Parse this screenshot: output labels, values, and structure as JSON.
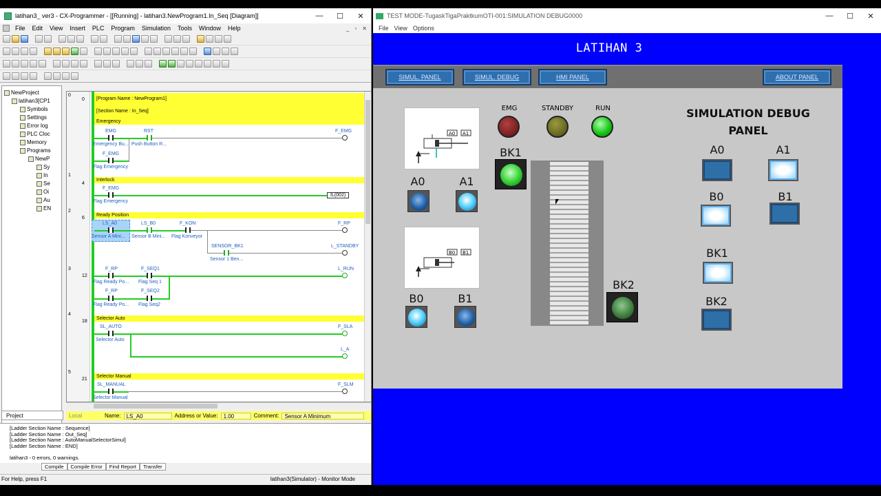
{
  "cx": {
    "title": "latihan3_ ver3 - CX-Programmer - [[Running] - latihan3.NewProgram1.In_Seq [Diagram]]",
    "menu": [
      "File",
      "Edit",
      "View",
      "Insert",
      "PLC",
      "Program",
      "Simulation",
      "Tools",
      "Window",
      "Help"
    ],
    "tree": [
      "NewProject",
      "latihan3[CP1",
      "Symbols",
      "Settings",
      "Error log",
      "PLC Cloc",
      "Memory",
      "Programs",
      "NewP",
      "Sy",
      "In",
      "Se",
      "Oi",
      "Au",
      "EN"
    ],
    "project_tab": "Project",
    "ladder": {
      "header_lines": [
        "[Program Name : NewProgram1]",
        "[Section Name : In_Seq]",
        "Emergency"
      ],
      "rungs": [
        {
          "num": "0",
          "step": "0"
        },
        {
          "num": "1",
          "step": "4"
        },
        {
          "num": "2",
          "step": "6"
        },
        {
          "num": "3",
          "step": "12"
        },
        {
          "num": "4",
          "step": "18"
        },
        {
          "num": "5",
          "step": "21"
        }
      ],
      "sections": [
        "Interlock",
        "Ready Position",
        "Selector Auto",
        "Selector Manual"
      ],
      "r0": {
        "c1_top": "EMG",
        "c1_bot": "Emergency Bu...",
        "c2_top": "RST",
        "c2_bot": "Push Button R...",
        "coil": "F_EMG",
        "c3_top": "F_EMG",
        "c3_bot": "Flag Emergency"
      },
      "r1": {
        "c_top": "F_EMG",
        "c_bot": "Flag Emergency",
        "box": "IL(002)"
      },
      "r2": {
        "c1_top": "LS_A0",
        "c1_bot": "Sensor A Mini...",
        "c2_top": "LS_B0",
        "c2_bot": "Sensor B Mini...",
        "c3_top": "F_KON",
        "c3_bot": "Flag Konveyor",
        "coil1": "F_RP",
        "c4_top": "SENSOR_BK1",
        "c4_bot": "Sensor 1 Ben...",
        "coil2": "L_STANDBY"
      },
      "r3": {
        "c1_top": "F_RP",
        "c1_bot": "Flag Ready Po...",
        "c2_top": "F_SEQ1",
        "c2_bot": "Flag Seq 1",
        "coil": "L_RUN",
        "c3_top": "F_RP",
        "c3_bot": "Flag Ready Po...",
        "c4_top": "F_SEQ2",
        "c4_bot": "Flag Seq2"
      },
      "r4": {
        "c_top": "SL_AUTO",
        "c_bot": "Selector Auto",
        "coil1": "F_SLA",
        "coil2": "L_A"
      },
      "r5": {
        "c_top": "SL_MANUAL",
        "c_bot": "Selector Manual",
        "coil": "F_SLM"
      }
    },
    "infobar": {
      "local": "Local",
      "name_label": "Name:",
      "name_value": "LS_A0",
      "addr_label": "Address or Value:",
      "addr_value": "1.00",
      "comment_label": "Comment:",
      "comment_value": "Sensor A Minimum"
    },
    "output_lines": [
      "[Ladder Section Name : Sequence]",
      "[Ladder Section Name : Out_Seq]",
      "[Ladder Section Name : AutoManualSelectorSimul]",
      "[Ladder Section Name : END]",
      "",
      "latihan3 - 0 errors, 0 warnings."
    ],
    "output_tabs": [
      "Compile",
      "Compile Error",
      "Find Report",
      "Transfer"
    ],
    "status_left": "For Help, press F1",
    "status_mode": "latihan3(Simulator) - Monitor Mode"
  },
  "sim": {
    "title": "TEST MODE-TugaskTigaPraktkumOTI-001:SIMULATION DEBUG0000",
    "menu": [
      "File",
      "View",
      "Options"
    ],
    "heading": "LATIHAN 3",
    "nav": [
      "SIMUL. PANEL",
      "SIMUL. DEBUG",
      "HMI PANEL",
      "ABOUT PANEL"
    ],
    "panel_title": "SIMULATION DEBUG PANEL",
    "lamps": {
      "emg": "EMG",
      "standby": "STANDBY",
      "run": "RUN"
    },
    "labels": {
      "bk1": "BK1",
      "bk2": "BK2",
      "a0": "A0",
      "a1": "A1",
      "b0": "B0",
      "b1": "B1"
    },
    "cyl_labels": {
      "a0": "A0",
      "a1": "A1",
      "b0": "B0",
      "b1": "B1"
    },
    "right_labels": {
      "a0": "A0",
      "a1": "A1",
      "b0": "B0",
      "b1": "B1",
      "bk1": "BK1",
      "bk2": "BK2"
    },
    "colors": {
      "window_bg": "#0000ff",
      "panel_bg": "#c8c8c8",
      "run_lamp": "#10c010",
      "emg_lamp": "#5a1010"
    }
  }
}
